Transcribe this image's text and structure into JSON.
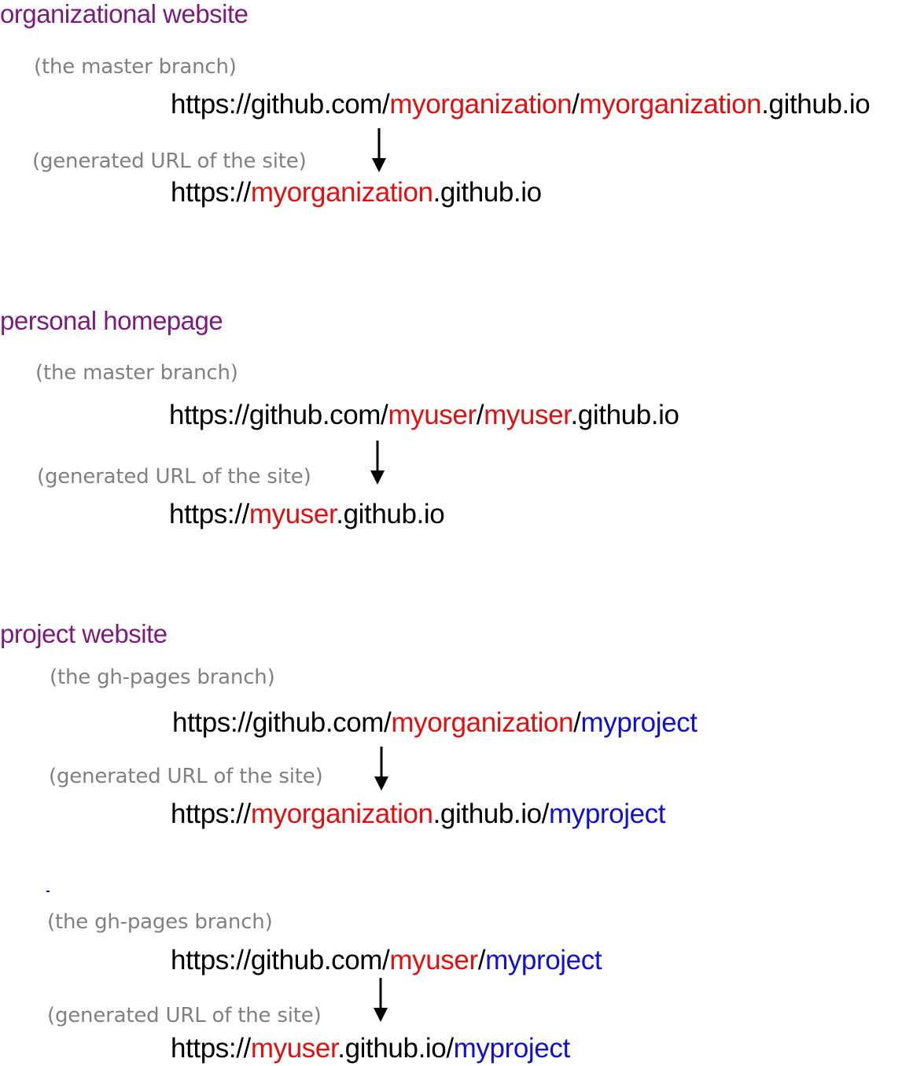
{
  "colors": {
    "heading": "#7b1b7e",
    "note": "#808080",
    "plain": "#000000",
    "owner": "#e01010",
    "project": "#1010d0"
  },
  "sections": [
    {
      "heading": "organizational website",
      "groups": [
        {
          "branch_note": "(the master branch)",
          "repo_url": [
            {
              "text": "https://github.com/",
              "role": "plain"
            },
            {
              "text": "myorganization",
              "role": "owner"
            },
            {
              "text": "/",
              "role": "plain"
            },
            {
              "text": "myorganization",
              "role": "owner"
            },
            {
              "text": ".github.io",
              "role": "plain"
            }
          ],
          "site_note": "(generated URL of the site)",
          "site_url": [
            {
              "text": "https://",
              "role": "plain"
            },
            {
              "text": "myorganization",
              "role": "owner"
            },
            {
              "text": ".github.io",
              "role": "plain"
            }
          ]
        }
      ]
    },
    {
      "heading": "personal homepage",
      "groups": [
        {
          "branch_note": "(the master branch)",
          "repo_url": [
            {
              "text": "https://github.com/",
              "role": "plain"
            },
            {
              "text": "myuser",
              "role": "owner"
            },
            {
              "text": "/",
              "role": "plain"
            },
            {
              "text": "myuser",
              "role": "owner"
            },
            {
              "text": ".github.io",
              "role": "plain"
            }
          ],
          "site_note": "(generated URL of the site)",
          "site_url": [
            {
              "text": "https://",
              "role": "plain"
            },
            {
              "text": "myuser",
              "role": "owner"
            },
            {
              "text": ".github.io",
              "role": "plain"
            }
          ]
        }
      ]
    },
    {
      "heading": "project website",
      "groups": [
        {
          "branch_note": "(the gh-pages branch)",
          "repo_url": [
            {
              "text": "https://github.com/",
              "role": "plain"
            },
            {
              "text": "myorganization",
              "role": "owner"
            },
            {
              "text": "/",
              "role": "plain"
            },
            {
              "text": "myproject",
              "role": "project"
            }
          ],
          "site_note": "(generated URL of the site)",
          "site_url": [
            {
              "text": "https://",
              "role": "plain"
            },
            {
              "text": "myorganization",
              "role": "owner"
            },
            {
              "text": ".github.io/",
              "role": "plain"
            },
            {
              "text": "myproject",
              "role": "project"
            }
          ]
        },
        {
          "branch_note": "(the gh-pages branch)",
          "repo_url": [
            {
              "text": "https://github.com/",
              "role": "plain"
            },
            {
              "text": "myuser",
              "role": "owner"
            },
            {
              "text": "/",
              "role": "plain"
            },
            {
              "text": "myproject",
              "role": "project"
            }
          ],
          "site_note": "(generated URL of the site)",
          "site_url": [
            {
              "text": "https://",
              "role": "plain"
            },
            {
              "text": "myuser",
              "role": "owner"
            },
            {
              "text": ".github.io/",
              "role": "plain"
            },
            {
              "text": "myproject",
              "role": "project"
            }
          ]
        }
      ]
    }
  ]
}
